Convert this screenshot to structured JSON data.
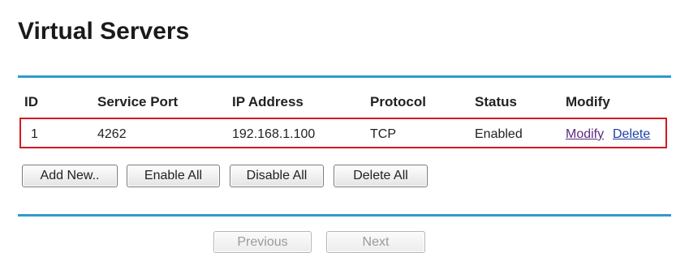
{
  "page": {
    "title": "Virtual Servers"
  },
  "table": {
    "headers": {
      "id": "ID",
      "service_port": "Service Port",
      "ip_address": "IP Address",
      "protocol": "Protocol",
      "status": "Status",
      "modify": "Modify"
    },
    "rows": [
      {
        "id": "1",
        "service_port": "4262",
        "ip_address": "192.168.1.100",
        "protocol": "TCP",
        "status": "Enabled",
        "modify_link": "Modify",
        "delete_link": "Delete"
      }
    ]
  },
  "actions": {
    "add_new": "Add New..",
    "enable_all": "Enable All",
    "disable_all": "Disable All",
    "delete_all": "Delete All"
  },
  "pagination": {
    "previous": "Previous",
    "next": "Next"
  },
  "colors": {
    "rule": "#2f9bc7",
    "highlight_border": "#d21b23",
    "link_visited": "#5a2d82",
    "link": "#1f3ea8"
  }
}
